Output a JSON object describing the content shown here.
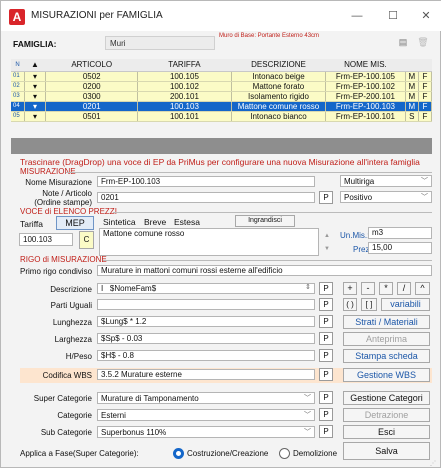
{
  "window": {
    "title": "MISURAZIONI per FAMIGLIA",
    "minimize": "—",
    "maximize": "☐",
    "close": "✕"
  },
  "famiglia": {
    "label": "FAMIGLIA:",
    "value": "Muri",
    "note": "Muro di Base: Portante Esterno 43cm"
  },
  "grid": {
    "headers": [
      "N",
      "ARTICOLO",
      "TARIFFA",
      "DESCRIZIONE",
      "NOME MIS.",
      "",
      ""
    ],
    "rows": [
      {
        "n": "01",
        "articolo": "0502",
        "tariffa": "100.105",
        "descrizione": "Intonaco beige",
        "nome": "Frm-EP-100.105",
        "c1": "M",
        "c2": "F"
      },
      {
        "n": "02",
        "articolo": "0200",
        "tariffa": "100.102",
        "descrizione": "Mattone forato",
        "nome": "Frm-EP-100.102",
        "c1": "M",
        "c2": "F"
      },
      {
        "n": "03",
        "articolo": "0300",
        "tariffa": "200.101",
        "descrizione": "Isolamento rigido",
        "nome": "Frm-EP-200.101",
        "c1": "M",
        "c2": "F"
      },
      {
        "n": "04",
        "articolo": "0201",
        "tariffa": "100.103",
        "descrizione": "Mattone comune rosso",
        "nome": "Frm-EP-100.103",
        "c1": "M",
        "c2": "F"
      },
      {
        "n": "05",
        "articolo": "0501",
        "tariffa": "100.101",
        "descrizione": "Intonaco bianco",
        "nome": "Frm-EP-100.101",
        "c1": "S",
        "c2": "F"
      }
    ]
  },
  "drag_note": "Trascinare (DragDrop) una voce di EP da PriMus per configurare una nuova Misurazione all'intera famiglia",
  "misurazione": {
    "section": "MISURAZIONE",
    "nome_label": "Nome Misurazione",
    "nome_value": "Frm-EP-100.103",
    "nome_select": "Multiriga",
    "note_label": "Note / Articolo",
    "note_label2": "(Ordine stampe)",
    "note_value": "0201",
    "note_select": "Positivo"
  },
  "voce": {
    "section": "VOCE di ELENCO PREZZI",
    "tariffa_label": "Tariffa",
    "mep_button": "MEP",
    "tab_sintetica": "Sintetica",
    "tab_breve": "Breve",
    "tab_estesa": "Estesa",
    "ingrandisci": "Ingrandisci",
    "tariffa_value": "100.103",
    "c_button": "C",
    "descr_value": "Mattone comune rosso",
    "unmis_label": "Un.Mis.:",
    "unmis_value": "m3",
    "prezzo_label": "Prezzo",
    "prezzo_value": "15,00"
  },
  "rigo": {
    "section": "RIGO di MISURAZIONE",
    "primo_label": "Primo rigo condiviso",
    "primo_value": "Murature in mattoni comuni rossi esterne all'edificio",
    "descr_label": "Descrizione",
    "descr_value": "$NomeFam$",
    "descr_prefix": "I",
    "parti_label": "Parti Uguali",
    "lung_label": "Lunghezza",
    "lung_value": "$Lung$ * 1.2",
    "larg_label": "Larghezza",
    "larg_value": "$Sp$ - 0.03",
    "hpeso_label": "H/Peso",
    "hpeso_value": "$H$ - 0.8",
    "wbs_label": "Codifica WBS",
    "wbs_value": "3.5.2 Murature esterne",
    "p": "P"
  },
  "ops": {
    "plus": "+",
    "minus": "-",
    "times": "*",
    "div": "/",
    "pow": "^",
    "paren": "( )",
    "brack": "[ ]",
    "variabili": "variabili"
  },
  "buttons": {
    "strati": "Strati / Materiali",
    "anteprima": "Anteprima",
    "stampa": "Stampa scheda",
    "wbs": "Gestione WBS",
    "categorie": "Gestione Categori",
    "detrazione": "Detrazione",
    "esci": "Esci",
    "salva": "Salva"
  },
  "categorie": {
    "super_label": "Super Categorie",
    "super_value": "Murature di Tamponamento",
    "cat_label": "Categorie",
    "cat_value": "Esterni",
    "sub_label": "Sub Categorie",
    "sub_value": "Superbonus 110%"
  },
  "fase": {
    "label": "Applica a Fase(Super Categorie):",
    "opt1": "Costruzione/Creazione",
    "opt2": "Demolizione",
    "selected": "Costruzione/Creazione"
  },
  "colors": {
    "accent_red": "#c0201a",
    "selected_row": "#1466c9",
    "row_bg": "#fbfbc6",
    "link_blue": "#1c57a8"
  }
}
